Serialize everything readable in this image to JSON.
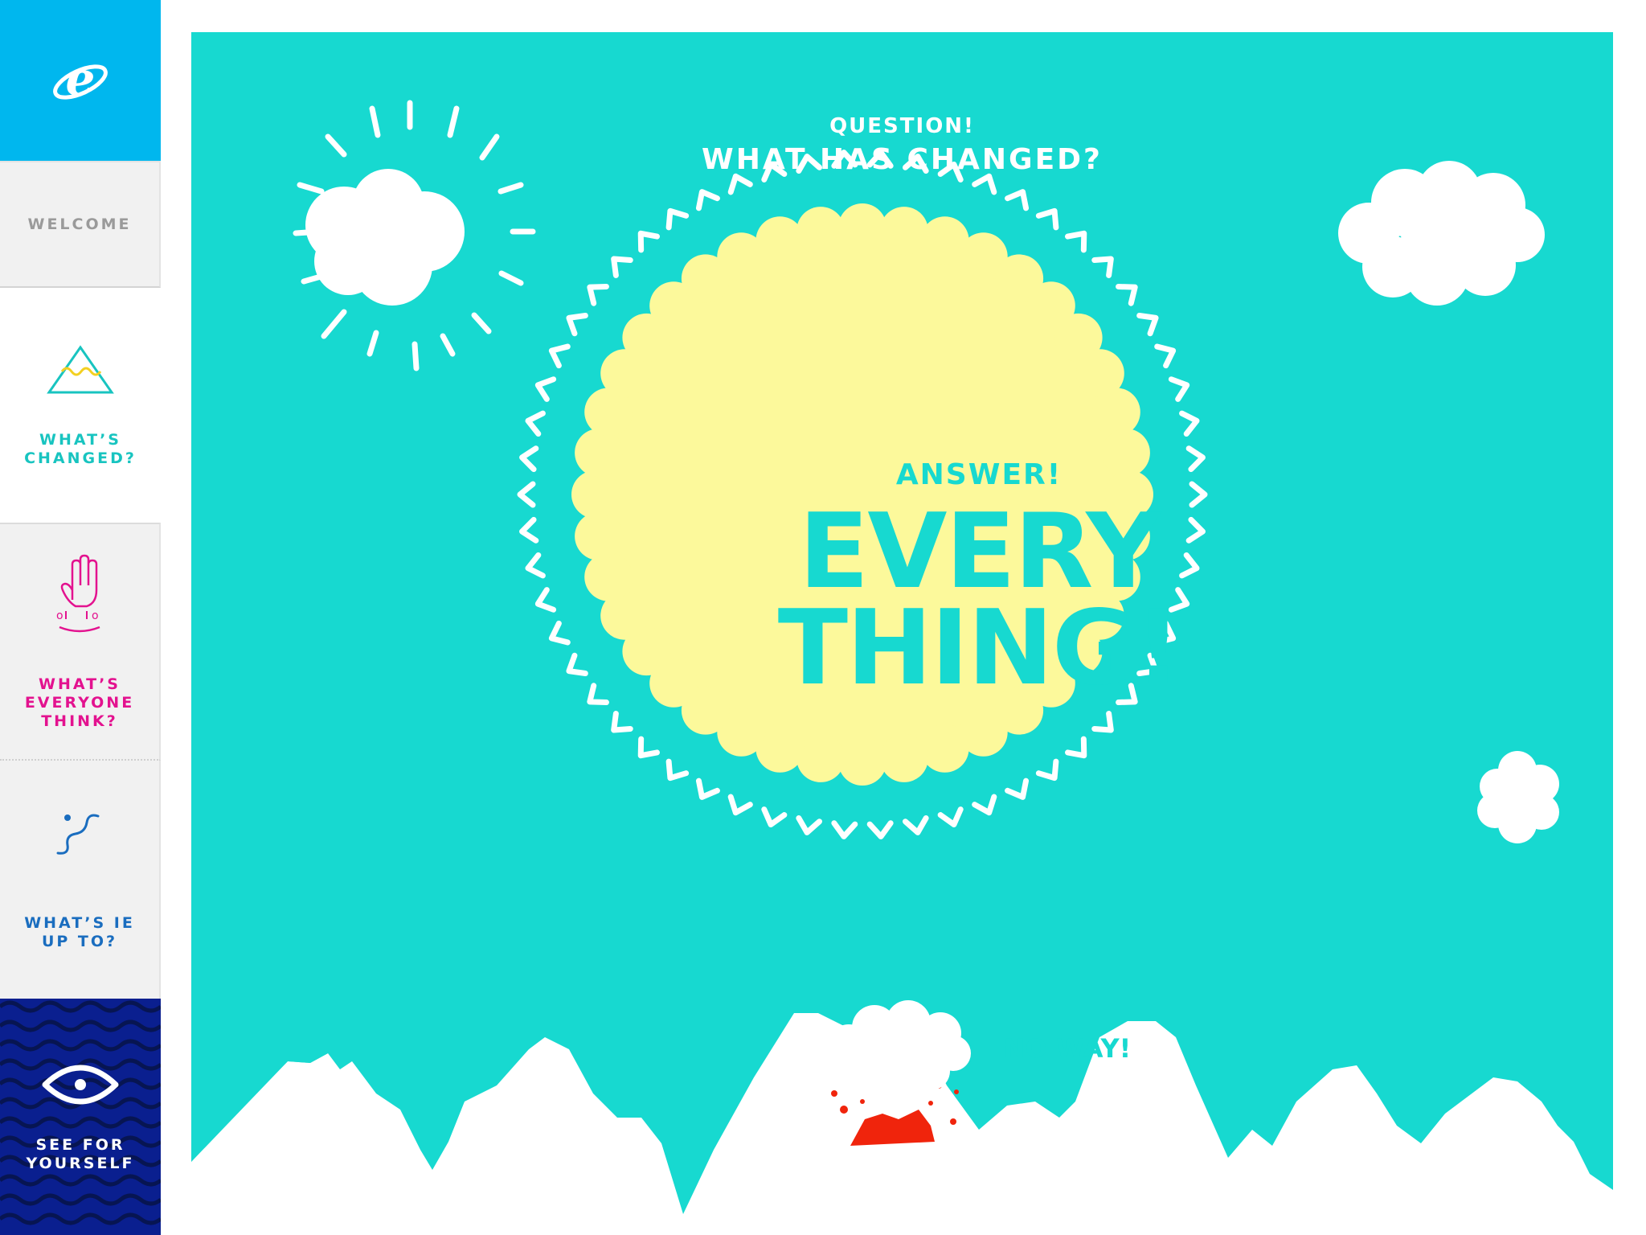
{
  "sidebar": {
    "logo_icon": "internet-explorer-logo-icon",
    "items": [
      {
        "id": "welcome",
        "label": "WELCOME",
        "icon": ""
      },
      {
        "id": "changed",
        "label": "WHAT’S\nCHANGED?",
        "icon": "mountain-triangle-icon",
        "color": "#18c4c0"
      },
      {
        "id": "think",
        "label": "WHAT’S\nEVERYONE\nTHINK?",
        "icon": "raised-hand-icon",
        "color": "#e3128f"
      },
      {
        "id": "upto",
        "label": "WHAT’S IE\nUP TO?",
        "icon": "squiggle-path-icon",
        "color": "#1a6dbf"
      },
      {
        "id": "see",
        "label": "SEE FOR\nYOURSELF",
        "icon": "eye-icon",
        "color": "#0a1f8f"
      }
    ]
  },
  "main": {
    "question_kicker": "QUESTION!",
    "question_title": "WHAT HAS CHANGED?",
    "answer_kicker": "ANSWER!",
    "answer_big": "EVERY\nTHING!",
    "volcano_bubble": "NO WAY!"
  },
  "colors": {
    "ie_blue": "#00b7ee",
    "stage_teal": "#17d9d0",
    "sun_yellow": "#fcf99b",
    "navy": "#0a1f8f",
    "volcano_red": "#f0240c"
  }
}
